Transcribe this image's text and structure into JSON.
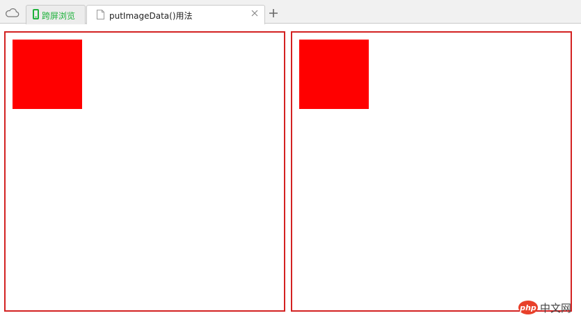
{
  "tabs": {
    "cross_screen_label": "跨屏浏览",
    "active_title": "putImageData()用法"
  },
  "icons": {
    "cloud": "cloud-icon",
    "phone": "phone-icon",
    "document": "document-icon",
    "close": "close-icon",
    "new_tab": "plus-icon"
  },
  "colors": {
    "square": "#ff0000",
    "canvas_border": "#d32121",
    "cross_screen_green": "#1db13a"
  },
  "watermark": {
    "logo": "php",
    "text": "中文网"
  }
}
